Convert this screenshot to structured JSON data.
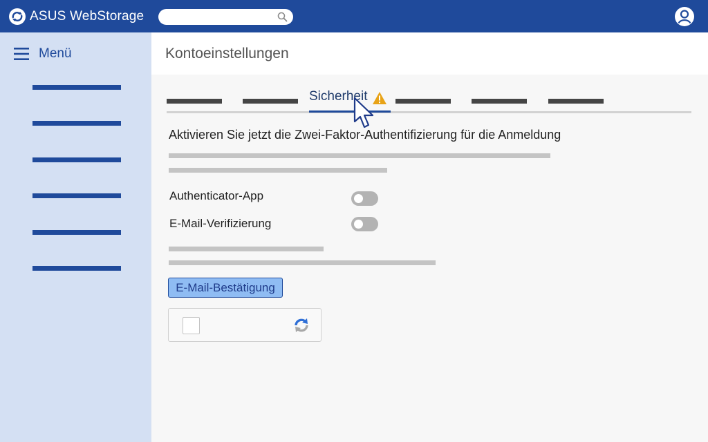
{
  "header": {
    "app_name": "ASUS WebStorage",
    "search_placeholder": "",
    "icons": {
      "logo": "cloud-sync-logo-icon",
      "search": "search-icon",
      "user": "user-account-icon"
    }
  },
  "sidebar": {
    "menu_label": "Menü",
    "menu_icon": "hamburger-icon",
    "item_count_visible": 6
  },
  "page": {
    "title": "Kontoeinstellungen"
  },
  "tabs": {
    "active_label": "Sicherheit",
    "active_badge_icon": "warning-icon"
  },
  "security": {
    "headline": "Aktivieren Sie jetzt die Zwei-Faktor-Authentifizierung für die Anmeldung",
    "options": [
      {
        "label": "Authenticator-App",
        "enabled": false
      },
      {
        "label": "E-Mail-Verifizierung",
        "enabled": false
      }
    ],
    "email_button_label": "E-Mail-Bestätigung",
    "captcha": {
      "checked": false,
      "icon": "recaptcha-icon"
    }
  },
  "colors": {
    "brand_blue": "#1f4a9b",
    "sidebar_bg": "#d4e0f3",
    "button_bg": "#8fbcf3",
    "warning": "#e8a317",
    "toggle_off": "#b3b3b3"
  }
}
